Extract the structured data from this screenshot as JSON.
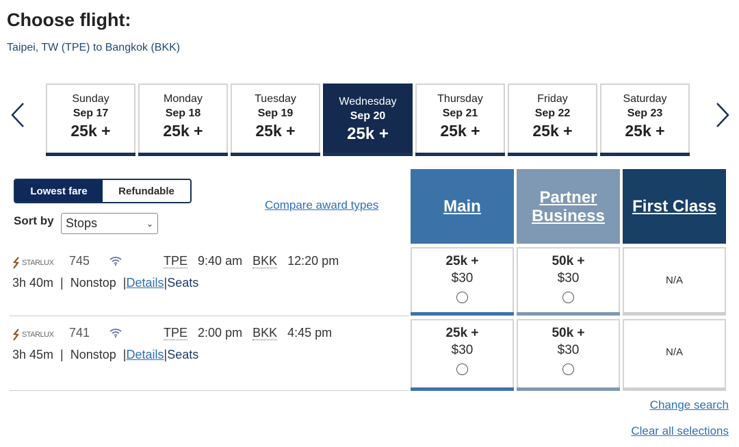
{
  "header": {
    "title": "Choose flight:",
    "route": "Taipei, TW (TPE) to Bangkok (BKK)"
  },
  "dates": [
    {
      "day": "Sunday",
      "date": "Sep 17",
      "price": "25k +"
    },
    {
      "day": "Monday",
      "date": "Sep 18",
      "price": "25k +"
    },
    {
      "day": "Tuesday",
      "date": "Sep 19",
      "price": "25k +"
    },
    {
      "day": "Wednesday",
      "date": "Sep 20",
      "price": "25k +",
      "selected": true
    },
    {
      "day": "Thursday",
      "date": "Sep 21",
      "price": "25k +"
    },
    {
      "day": "Friday",
      "date": "Sep 22",
      "price": "25k +"
    },
    {
      "day": "Saturday",
      "date": "Sep 23",
      "price": "25k +"
    }
  ],
  "filters": {
    "toggle": [
      "Lowest fare",
      "Refundable"
    ],
    "active": "Lowest fare",
    "sort_label": "Sort by",
    "sort_value": "Stops",
    "compare": "Compare award types"
  },
  "columns": [
    {
      "label_1": "Main",
      "label_2": "",
      "color": "#3b73a9"
    },
    {
      "label_1": "Partner",
      "label_2": "Business",
      "color": "#7f98b3"
    },
    {
      "label_1": "First Class",
      "label_2": "",
      "color": "#183f66"
    }
  ],
  "flights": [
    {
      "airline": "STARLUX",
      "number": "745",
      "from": "TPE",
      "depart": "9:40 am",
      "to": "BKK",
      "arrive": "12:20 pm",
      "duration": "3h 40m",
      "stops": "Nonstop",
      "details": "Details",
      "seats": "Seats",
      "fares": [
        {
          "points": "25k +",
          "cash": "$30"
        },
        {
          "points": "50k +",
          "cash": "$30"
        },
        {
          "na": "N/A"
        }
      ]
    },
    {
      "airline": "STARLUX",
      "number": "741",
      "from": "TPE",
      "depart": "2:00 pm",
      "to": "BKK",
      "arrive": "4:45 pm",
      "duration": "3h 45m",
      "stops": "Nonstop",
      "details": "Details",
      "seats": "Seats",
      "fares": [
        {
          "points": "25k +",
          "cash": "$30"
        },
        {
          "points": "50k +",
          "cash": "$30"
        },
        {
          "na": "N/A"
        }
      ]
    }
  ],
  "footer": {
    "change": "Change search",
    "clear": "Clear all selections"
  }
}
